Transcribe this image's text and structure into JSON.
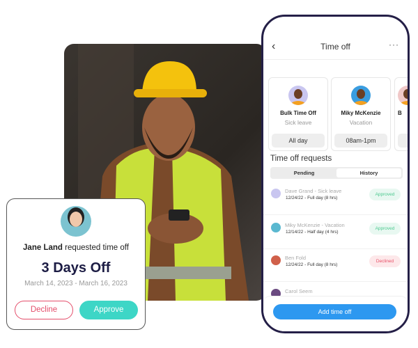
{
  "phone": {
    "title": "Time off",
    "back_icon": "chevron-left-icon",
    "more_icon": "more-icon",
    "cards": [
      {
        "name": "Bulk Time Off",
        "type": "Sick leave",
        "time": "All day",
        "avatar_bg": "#c9c6f0"
      },
      {
        "name": "Miky McKenzie",
        "type": "Vacation",
        "time": "08am-1pm",
        "avatar_bg": "#3a9de0"
      },
      {
        "name": "B",
        "type": "",
        "time": "",
        "avatar_bg": "#f0c8c8"
      }
    ],
    "section_title": "Time off requests",
    "tabs": {
      "pending": "Pending",
      "history": "History"
    },
    "requests": [
      {
        "title": "Dave Grand - Sick leave",
        "detail": "12/24/22 - Full day (8 hrs)",
        "status": "Approved",
        "avatar_bg": "#c9c6f0"
      },
      {
        "title": "Miky McKenzie - Vacation",
        "detail": "12/14/22 - Half day (4 hrs)",
        "status": "Approved",
        "avatar_bg": "#5ab8d0"
      },
      {
        "title": "Ben Fold",
        "detail": "12/24/22 - Full day (8 hrs)",
        "status": "Declined",
        "avatar_bg": "#d0604a"
      },
      {
        "title": "Carol Seem",
        "detail": "",
        "status": "",
        "avatar_bg": "#6a4a80"
      }
    ],
    "add_button": "Add time off"
  },
  "request_card": {
    "name": "Jane Land",
    "action": " requested time off",
    "days": "3 Days Off",
    "dates": "March 14, 2023 - March 16, 2023",
    "decline": "Decline",
    "approve": "Approve"
  },
  "colors": {
    "approved_bg": "#e8f8f1",
    "approved_text": "#4cc98f",
    "declined_bg": "#fde8ea",
    "declined_text": "#e85068",
    "primary": "#2d98f0",
    "approve": "#3dd6c6"
  }
}
